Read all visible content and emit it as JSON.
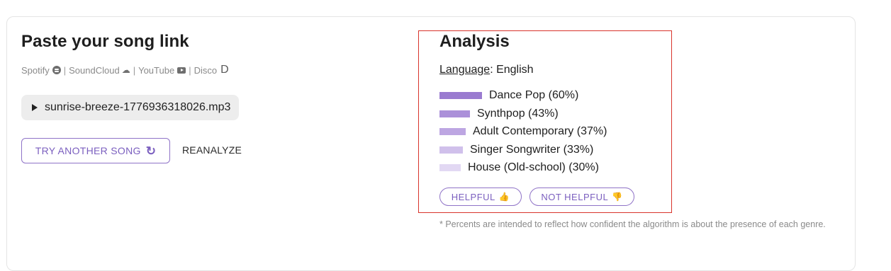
{
  "left": {
    "title": "Paste your song link",
    "sources": [
      {
        "label": "Spotify",
        "icon": "spotify-icon"
      },
      {
        "label": "SoundCloud",
        "icon": "soundcloud-icon"
      },
      {
        "label": "YouTube",
        "icon": "youtube-icon"
      },
      {
        "label": "Disco",
        "icon": "disco-icon",
        "icon_glyph": "D"
      }
    ],
    "separator": "|",
    "file_name": "sunrise-breeze-1776936318026.mp3",
    "try_another_label": "TRY ANOTHER SONG",
    "reanalyze_label": "REANALYZE"
  },
  "analysis": {
    "title": "Analysis",
    "language_label": "Language",
    "language_sep": ": ",
    "language_value": "English",
    "genres": [
      {
        "label": "Dance Pop (60%)",
        "percent": 60,
        "color": "#9a7bd0"
      },
      {
        "label": "Synthpop (43%)",
        "percent": 43,
        "color": "#ab90d9"
      },
      {
        "label": "Adult Contemporary (37%)",
        "percent": 37,
        "color": "#bda6e2"
      },
      {
        "label": "Singer Songwriter (33%)",
        "percent": 33,
        "color": "#d0c0eb"
      },
      {
        "label": "House (Old-school) (30%)",
        "percent": 30,
        "color": "#e2d8f3"
      }
    ],
    "helpful_label": "HELPFUL",
    "not_helpful_label": "NOT HELPFUL",
    "footnote": "* Percents are intended to reflect how confident the algorithm is about the presence of each genre."
  },
  "colors": {
    "accent": "#7b5fbf",
    "highlight_border": "#d9342b"
  }
}
